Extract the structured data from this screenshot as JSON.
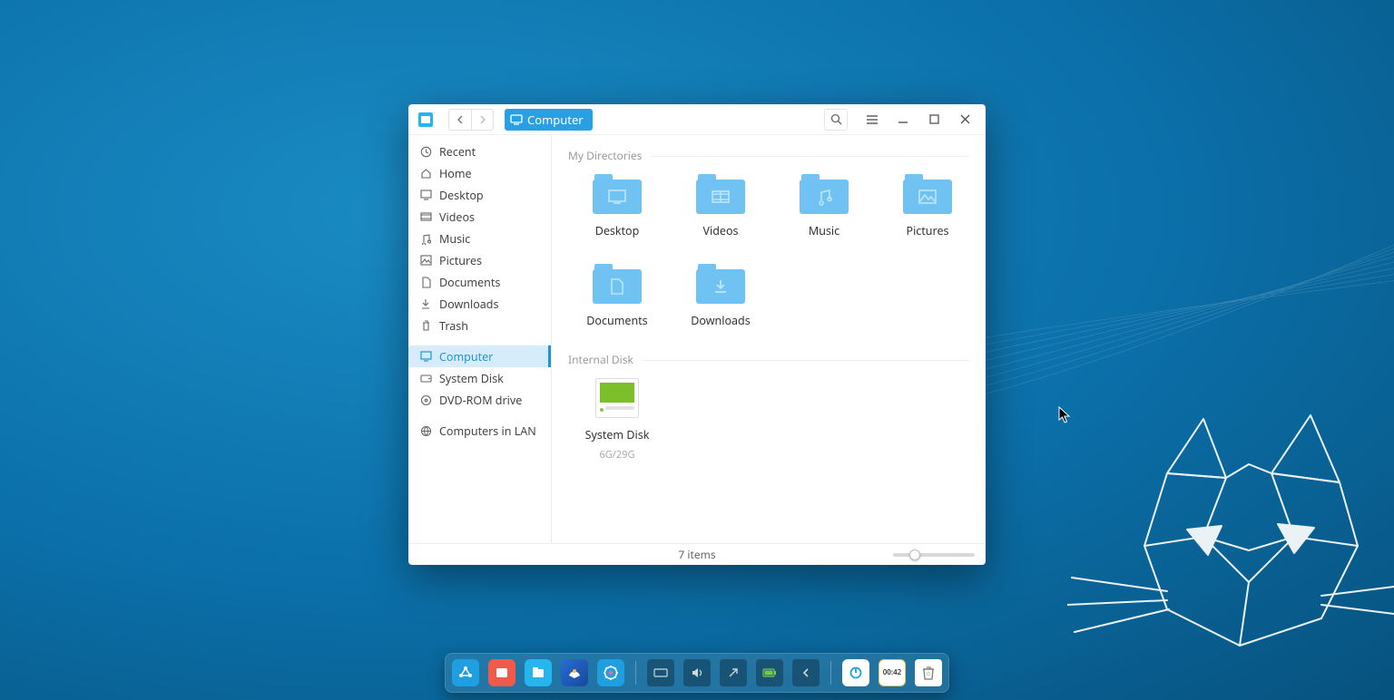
{
  "breadcrumb": {
    "label": "Computer"
  },
  "sidebar": {
    "items": [
      {
        "label": "Recent",
        "icon": "clock-icon"
      },
      {
        "label": "Home",
        "icon": "home-icon"
      },
      {
        "label": "Desktop",
        "icon": "desktop-icon"
      },
      {
        "label": "Videos",
        "icon": "video-icon"
      },
      {
        "label": "Music",
        "icon": "music-icon"
      },
      {
        "label": "Pictures",
        "icon": "picture-icon"
      },
      {
        "label": "Documents",
        "icon": "document-icon"
      },
      {
        "label": "Downloads",
        "icon": "download-icon"
      },
      {
        "label": "Trash",
        "icon": "trash-icon"
      }
    ],
    "devices": [
      {
        "label": "Computer",
        "icon": "computer-icon",
        "active": true
      },
      {
        "label": "System Disk",
        "icon": "disk-icon"
      },
      {
        "label": "DVD-ROM drive",
        "icon": "dvd-icon"
      }
    ],
    "network": [
      {
        "label": "Computers in LAN",
        "icon": "lan-icon"
      }
    ]
  },
  "sections": {
    "my_directories": {
      "title": "My Directories",
      "items": [
        {
          "label": "Desktop",
          "glyph": "desktop"
        },
        {
          "label": "Videos",
          "glyph": "video"
        },
        {
          "label": "Music",
          "glyph": "music"
        },
        {
          "label": "Pictures",
          "glyph": "picture"
        },
        {
          "label": "Documents",
          "glyph": "document"
        },
        {
          "label": "Downloads",
          "glyph": "download"
        }
      ]
    },
    "internal_disk": {
      "title": "Internal Disk",
      "items": [
        {
          "label": "System Disk",
          "usage": "6G/29G"
        }
      ]
    }
  },
  "statusbar": {
    "count_text": "7 items"
  },
  "dock": {
    "apps": [
      {
        "name": "launcher",
        "color": "#1f9fe0"
      },
      {
        "name": "multitask",
        "color": "#ef5a4a"
      },
      {
        "name": "file-manager",
        "color": "#25b6ef"
      },
      {
        "name": "browser",
        "color": "#1f9fe0"
      },
      {
        "name": "settings",
        "color": "#1f9fe0"
      }
    ],
    "tray": [
      {
        "name": "keyboard-icon"
      },
      {
        "name": "volume-icon"
      },
      {
        "name": "usb-icon"
      },
      {
        "name": "battery-icon"
      },
      {
        "name": "chevron-left-icon"
      }
    ],
    "right": [
      {
        "name": "power-icon"
      },
      {
        "name": "clock-widget",
        "text": "00:42"
      },
      {
        "name": "trash-dock"
      }
    ]
  },
  "colors": {
    "accent": "#2aa0e4",
    "folder": "#6fc2f2"
  }
}
